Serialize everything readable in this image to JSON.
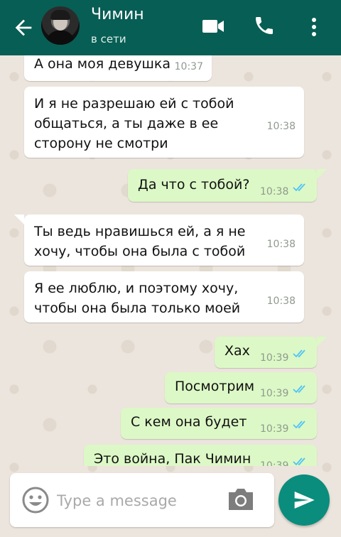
{
  "header": {
    "contact_name": "Чимин",
    "status": "в сети"
  },
  "messages": [
    {
      "direction": "in",
      "text": "А она моя девушка",
      "time": "10:37"
    },
    {
      "direction": "in",
      "text": "И я не разрешаю ей с тобой общаться, а ты даже в ее сторону не смотри",
      "time": "10:38"
    },
    {
      "direction": "out",
      "text": "Да что с тобой?",
      "time": "10:38",
      "read": true
    },
    {
      "direction": "in",
      "text": "Ты ведь нравишься ей, а я не хочу, чтобы она была с тобой",
      "time": "10:38"
    },
    {
      "direction": "in",
      "text": "Я ее люблю, и поэтому хочу, чтобы она была только моей",
      "time": "10:38"
    },
    {
      "direction": "out",
      "text": "Хах",
      "time": "10:39",
      "read": true
    },
    {
      "direction": "out",
      "text": "Посмотрим",
      "time": "10:39",
      "read": true
    },
    {
      "direction": "out",
      "text": "С кем она будет",
      "time": "10:39",
      "read": true
    },
    {
      "direction": "out",
      "text": "Это война, Пак Чимин",
      "time": "10:39",
      "read": true
    }
  ],
  "composer": {
    "placeholder": "Type a message"
  },
  "colors": {
    "header": "#075e54",
    "outgoing_bubble": "#dcf8c6",
    "incoming_bubble": "#ffffff",
    "read_ticks": "#4fc3f7",
    "send_button": "#0a8d7c"
  },
  "icons": [
    "back-arrow-icon",
    "video-call-icon",
    "phone-icon",
    "more-options-icon",
    "emoji-icon",
    "camera-icon",
    "send-icon"
  ]
}
